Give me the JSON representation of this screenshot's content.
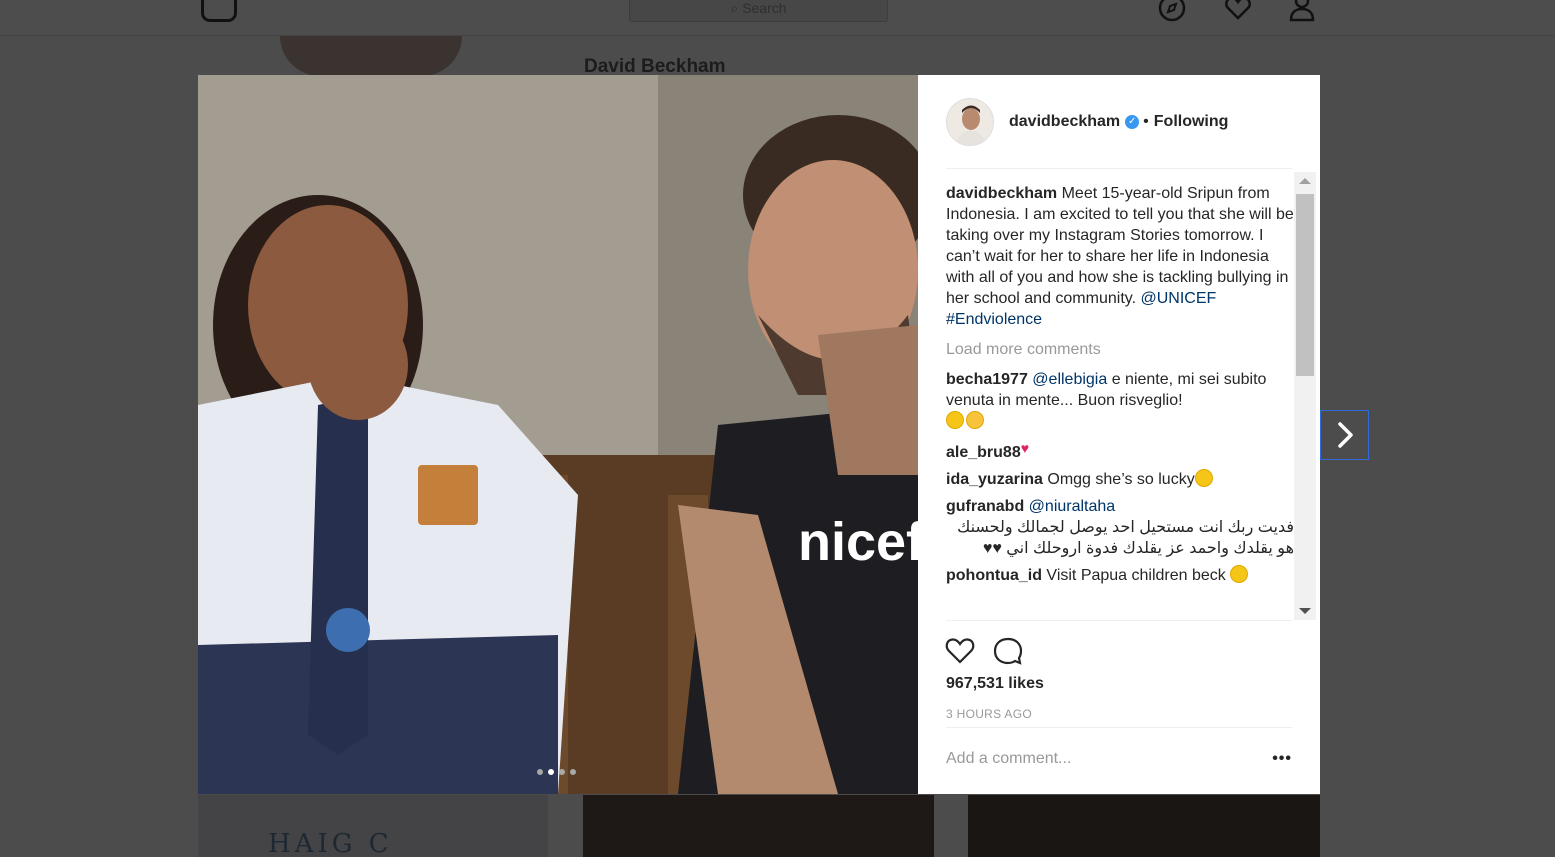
{
  "topbar": {
    "search_placeholder": "Search"
  },
  "background": {
    "profile_name": "David Beckham",
    "thumb1_text": "HAIG C"
  },
  "post": {
    "username": "davidbeckham",
    "separator": "•",
    "follow_status": "Following",
    "carousel": {
      "count": 4,
      "active_index": 1
    },
    "caption": {
      "user": "davidbeckham",
      "text": " Meet 15-year-old Sripun from Indonesia. I am excited to tell you that she will be taking over my Instagram Stories tomorrow. I can’t wait for her to share her life in Indonesia with all of you and how she is tackling bullying in her school and community. ",
      "mention": "@UNICEF",
      "hashtag": "#Endviolence"
    },
    "load_more": "Load more comments",
    "comments": [
      {
        "user": "becha1977",
        "mention": "@ellebigia",
        "text": " e niente, mi sei subito venuta in mente... Buon risveglio!"
      },
      {
        "user": "ale_bru88",
        "text": ""
      },
      {
        "user": "ida_yuzarina",
        "text": " Omgg she’s so lucky"
      },
      {
        "user": "gufranabd",
        "mention": "@niuraltaha",
        "text": "فديت ربك انت مستحيل احد يوصل لجمالك ولحسنك هو يقلدك واحمد عز يقلدك فدوة اروحلك اني ♥♥"
      },
      {
        "user": "pohontua_id",
        "text": " Visit Papua children beck "
      }
    ],
    "likes": "967,531 likes",
    "timestamp": "3 HOURS AGO",
    "add_comment_placeholder": "Add a comment...",
    "more_label": "•••"
  },
  "icons": {
    "logo": "instagram-logo",
    "explore": "compass-icon",
    "activity": "heart-icon",
    "profile": "person-icon",
    "like": "heart-icon",
    "comment": "speech-bubble-icon",
    "next": "chevron-right-icon"
  }
}
